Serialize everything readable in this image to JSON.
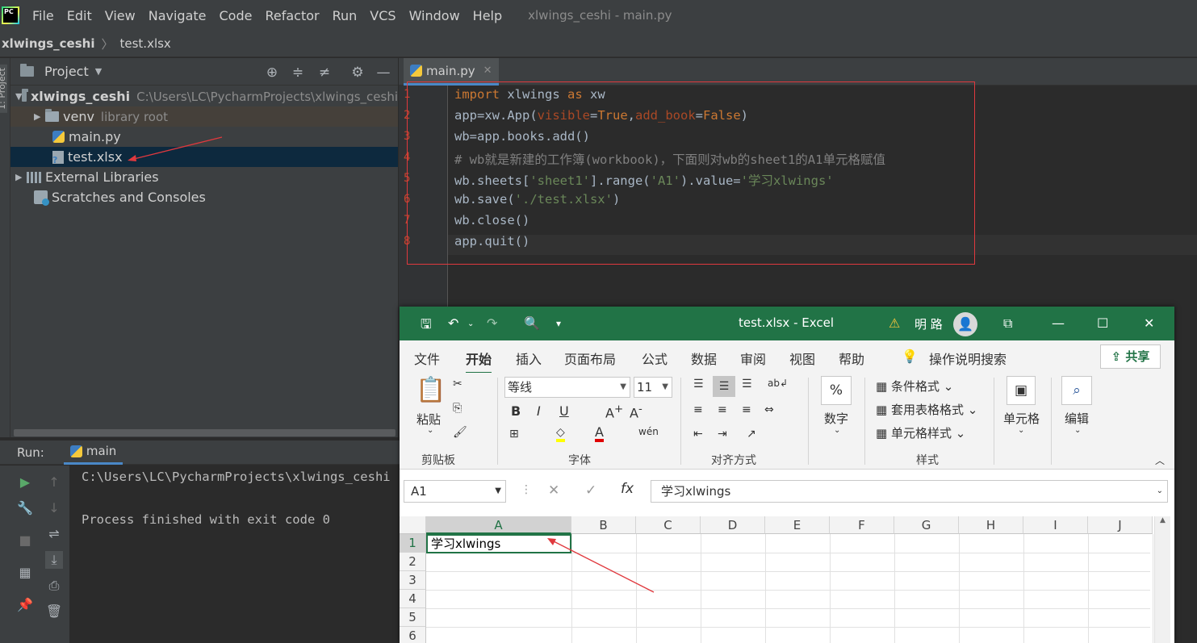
{
  "menubar": {
    "logo_text": "PC",
    "items": [
      "File",
      "Edit",
      "View",
      "Navigate",
      "Code",
      "Refactor",
      "Run",
      "VCS",
      "Window",
      "Help"
    ],
    "window_title": "xlwings_ceshi - main.py"
  },
  "breadcrumb": {
    "project": "xlwings_ceshi",
    "file": "test.xlsx"
  },
  "left_stripe": {
    "label": "1: Project"
  },
  "project_panel": {
    "title": "Project",
    "tree": [
      {
        "label": "xlwings_ceshi",
        "hint": "C:\\Users\\LC\\PycharmProjects\\xlwings_ceshi"
      },
      {
        "label": "venv",
        "hint": "library root"
      },
      {
        "label": "main.py"
      },
      {
        "label": "test.xlsx"
      },
      {
        "label": "External Libraries"
      },
      {
        "label": "Scratches and Consoles"
      }
    ]
  },
  "editor": {
    "tab_label": "main.py",
    "line_numbers": [
      "1",
      "2",
      "3",
      "4",
      "5",
      "6",
      "7",
      "8"
    ],
    "lines": [
      [
        {
          "t": "import",
          "c": "kw"
        },
        {
          "t": " xlwings ",
          "c": ""
        },
        {
          "t": "as",
          "c": "kw"
        },
        {
          "t": " xw",
          "c": ""
        }
      ],
      [
        {
          "t": "app=xw.App(",
          "c": ""
        },
        {
          "t": "visible",
          "c": "kwarg"
        },
        {
          "t": "=",
          "c": ""
        },
        {
          "t": "True",
          "c": "kw"
        },
        {
          "t": ",",
          "c": ""
        },
        {
          "t": "add_book",
          "c": "kwarg"
        },
        {
          "t": "=",
          "c": ""
        },
        {
          "t": "False",
          "c": "kw"
        },
        {
          "t": ")",
          "c": ""
        }
      ],
      [
        {
          "t": "wb=app.books.add()",
          "c": ""
        }
      ],
      [
        {
          "t": "# wb就是新建的工作簿(workbook)，下面则对wb的sheet1的A1单元格赋值",
          "c": "cm"
        }
      ],
      [
        {
          "t": "wb.sheets[",
          "c": ""
        },
        {
          "t": "'sheet1'",
          "c": "str"
        },
        {
          "t": "].range(",
          "c": ""
        },
        {
          "t": "'A1'",
          "c": "str"
        },
        {
          "t": ").value=",
          "c": ""
        },
        {
          "t": "'学习xlwings'",
          "c": "str"
        }
      ],
      [
        {
          "t": "wb.save(",
          "c": ""
        },
        {
          "t": "'./test.xlsx'",
          "c": "str"
        },
        {
          "t": ")",
          "c": ""
        }
      ],
      [
        {
          "t": "wb.close()",
          "c": ""
        }
      ],
      [
        {
          "t": "app.quit()",
          "c": ""
        }
      ]
    ]
  },
  "run_panel": {
    "label": "Run:",
    "tab": "main",
    "output": [
      "C:\\Users\\LC\\PycharmProjects\\xlwings_ceshi",
      "",
      "Process finished with exit code 0"
    ]
  },
  "excel": {
    "title": "test.xlsx  -  Excel",
    "user": "明 路",
    "ribbon_tabs": [
      "文件",
      "开始",
      "插入",
      "页面布局",
      "公式",
      "数据",
      "审阅",
      "视图",
      "帮助"
    ],
    "selected_tab": "开始",
    "tell_me": "操作说明搜索",
    "share": "共享",
    "paste": "粘贴",
    "font_name": "等线",
    "font_size": "11",
    "number_label": "数字",
    "number_icon": "%",
    "styles": [
      "条件格式",
      "套用表格格式",
      "单元格样式"
    ],
    "cells_label": "单元格",
    "editing_label": "编辑",
    "group_labels": [
      "剪贴板",
      "字体",
      "对齐方式",
      "样式"
    ],
    "name_box": "A1",
    "formula": "学习xlwings",
    "columns": [
      "A",
      "B",
      "C",
      "D",
      "E",
      "F",
      "G",
      "H",
      "I",
      "J"
    ],
    "rows": [
      "1",
      "2",
      "3",
      "4",
      "5",
      "6"
    ],
    "cell_a1": "学习xlwings"
  },
  "colors": {
    "accent": "#217346",
    "ide_bg": "#2b2b2b",
    "annotation": "#e0393e"
  }
}
